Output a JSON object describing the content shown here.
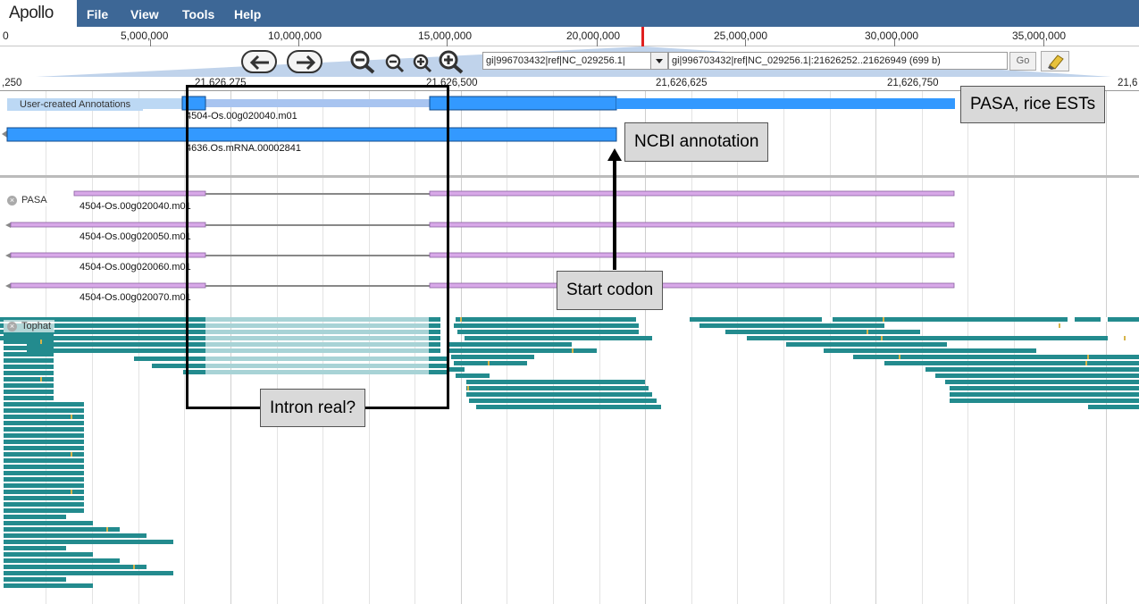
{
  "app": {
    "logo": "Apollo"
  },
  "menu": [
    {
      "id": "file",
      "label": "File"
    },
    {
      "id": "view",
      "label": "View"
    },
    {
      "id": "tools",
      "label": "Tools"
    },
    {
      "id": "help",
      "label": "Help"
    }
  ],
  "overview": {
    "labels": [
      "0",
      "5,000,000",
      "10,000,000",
      "15,000,000",
      "20,000,000",
      "25,000,000",
      "30,000,000",
      "35,000,000"
    ]
  },
  "navigation": {
    "reference_sequence": "gi|996703432|ref|NC_029256.1|",
    "location": "gi|996703432|ref|NC_029256.1|:21626252..21626949 (699 b)",
    "go_label": "Go"
  },
  "ruler": {
    "labels": [
      ",250",
      "21,626,275",
      "21,626,500",
      "21,626,625",
      "21,626,750",
      "21,6"
    ]
  },
  "tracks": {
    "user_created": {
      "label": "User-created Annotations",
      "features": [
        "4504-Os.00g020040.m01",
        "4636.Os.mRNA.00002841"
      ]
    },
    "pasa": {
      "label": "PASA",
      "features": [
        "4504-Os.00g020040.m01",
        "4504-Os.00g020050.m01",
        "4504-Os.00g020060.m01",
        "4504-Os.00g020070.m01"
      ]
    },
    "tophat": {
      "label": "Tophat"
    }
  },
  "annotations": {
    "pasa_ests": "PASA, rice ESTs",
    "ncbi": "NCBI annotation",
    "start_codon": "Start codon",
    "intron": "Intron real?"
  },
  "colors": {
    "menubar": "#3d6796",
    "cds_blue": "#3399ff",
    "utr_blue": "#a8c4f0",
    "pasa_purple": "#d8a8e8",
    "tophat_teal": "#238b8e",
    "tophat_light": "#a8d3d6",
    "mismatch": "#d6b44a"
  }
}
